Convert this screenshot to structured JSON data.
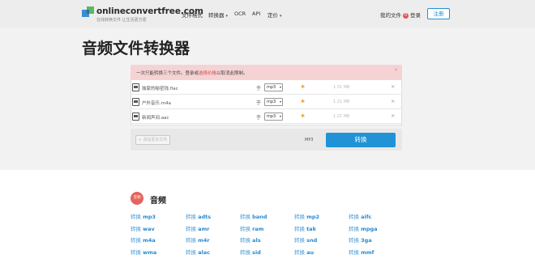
{
  "header": {
    "logo_title": "onlineconvertfree.com",
    "logo_subtitle": "在线转换文件 让生活更方便",
    "nav": [
      {
        "label": "文件格式",
        "has_caret": false
      },
      {
        "label": "转换器",
        "has_caret": true
      },
      {
        "label": "OCR",
        "has_caret": false
      },
      {
        "label": "API",
        "has_caret": false
      },
      {
        "label": "定价",
        "has_caret": true
      }
    ],
    "my_files": "我的文件",
    "my_files_badge": "0",
    "login": "登录",
    "register": "注册"
  },
  "page_title": "音频文件转换器",
  "notice": {
    "text_before": "一次只能转换三个文件。登录或",
    "link": "选择价格",
    "text_after": "以取消此限制。",
    "close": "×"
  },
  "files": [
    {
      "name": "独家的秘密钱.flac",
      "to": "于",
      "format": "mp3",
      "size": "1.31 MB",
      "close": "×"
    },
    {
      "name": "户外音乐.m4a",
      "to": "于",
      "format": "mp3",
      "size": "1.21 MB",
      "close": "×"
    },
    {
      "name": "新闻声间.aac",
      "to": "于",
      "format": "mp3",
      "size": "1.21 MB",
      "close": "×"
    }
  ],
  "action_bar": {
    "add_more": "+ 添加更多文件",
    "target_format": "MP3",
    "convert_button": "转换"
  },
  "audio_section": {
    "icon_label": "音频",
    "title": "音频",
    "link_prefix": "转换",
    "columns": [
      [
        "mp3",
        "wav",
        "m4a",
        "wma"
      ],
      [
        "adts",
        "amr",
        "m4r",
        "alac"
      ],
      [
        "band",
        "ram",
        "als",
        "sid"
      ],
      [
        "mp2",
        "tak",
        "snd",
        "au"
      ],
      [
        "aifc",
        "mpga",
        "3ga",
        "mmf"
      ]
    ]
  },
  "colors": {
    "accent": "#1f93d6",
    "notice_bg": "#f5d3d5",
    "audio_icon": "#e5645d",
    "link": "#2b8ad0"
  }
}
